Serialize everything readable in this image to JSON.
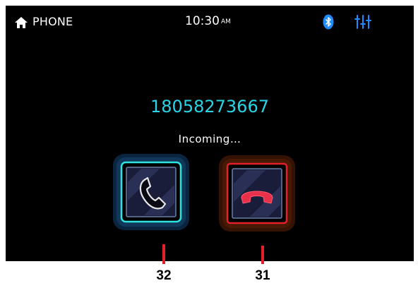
{
  "status_bar": {
    "app_name": "PHONE",
    "time": "10:30",
    "ampm": "AM",
    "icons": [
      "home-icon",
      "bluetooth-icon",
      "equalizer-icon"
    ]
  },
  "call": {
    "number": "18058273667",
    "status": "Incoming…"
  },
  "buttons": {
    "accept": {
      "icon": "phone-handset-icon",
      "border_color": "#2de3e0"
    },
    "reject": {
      "icon": "hang-up-icon",
      "border_color": "#e3202a"
    }
  },
  "callouts": [
    {
      "label": "32",
      "target": "accept-call-button"
    },
    {
      "label": "31",
      "target": "reject-call-button"
    }
  ],
  "colors": {
    "accent_cyan": "#2ad4e6",
    "bluetooth_blue": "#1e8bff",
    "reject_red": "#e3202a",
    "callout_red": "#e0202a"
  }
}
